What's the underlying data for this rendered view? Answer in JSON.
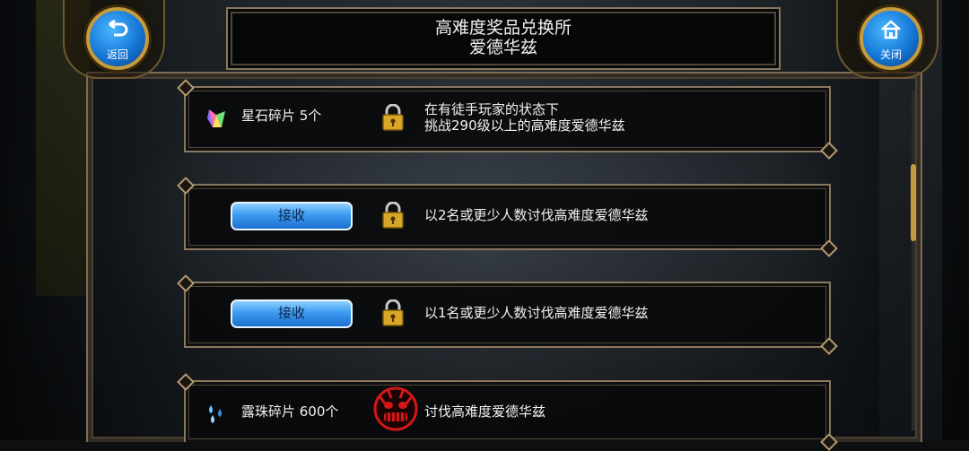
{
  "header": {
    "title_line1": "高难度奖品兑换所",
    "title_line2": "爱德华兹",
    "back_label": "返回",
    "close_label": "关闭"
  },
  "rows": [
    {
      "reward_icon": "crystal-shard-icon",
      "reward_text": "星石碎片 5个",
      "status_icon": "lock-icon",
      "condition_line1": "在有徒手玩家的状态下",
      "condition_line2": "挑战290级以上的高难度爱德华兹"
    },
    {
      "button_label": "接收",
      "status_icon": "lock-icon",
      "condition_line1": "以2名或更少人数讨伐高难度爱德华兹"
    },
    {
      "button_label": "接收",
      "status_icon": "lock-icon",
      "condition_line1": "以1名或更少人数讨伐高难度爱德华兹"
    },
    {
      "reward_icon": "dew-drops-icon",
      "reward_text": "露珠碎片 600个",
      "status_icon": "demon-mask-icon",
      "condition_line1": "讨伐高难度爱德华兹"
    }
  ],
  "colors": {
    "frame_gold": "#8a7760",
    "button_blue": "#3c9bf0",
    "scroll_thumb": "#c79a3e",
    "demon_red": "#d01818"
  }
}
